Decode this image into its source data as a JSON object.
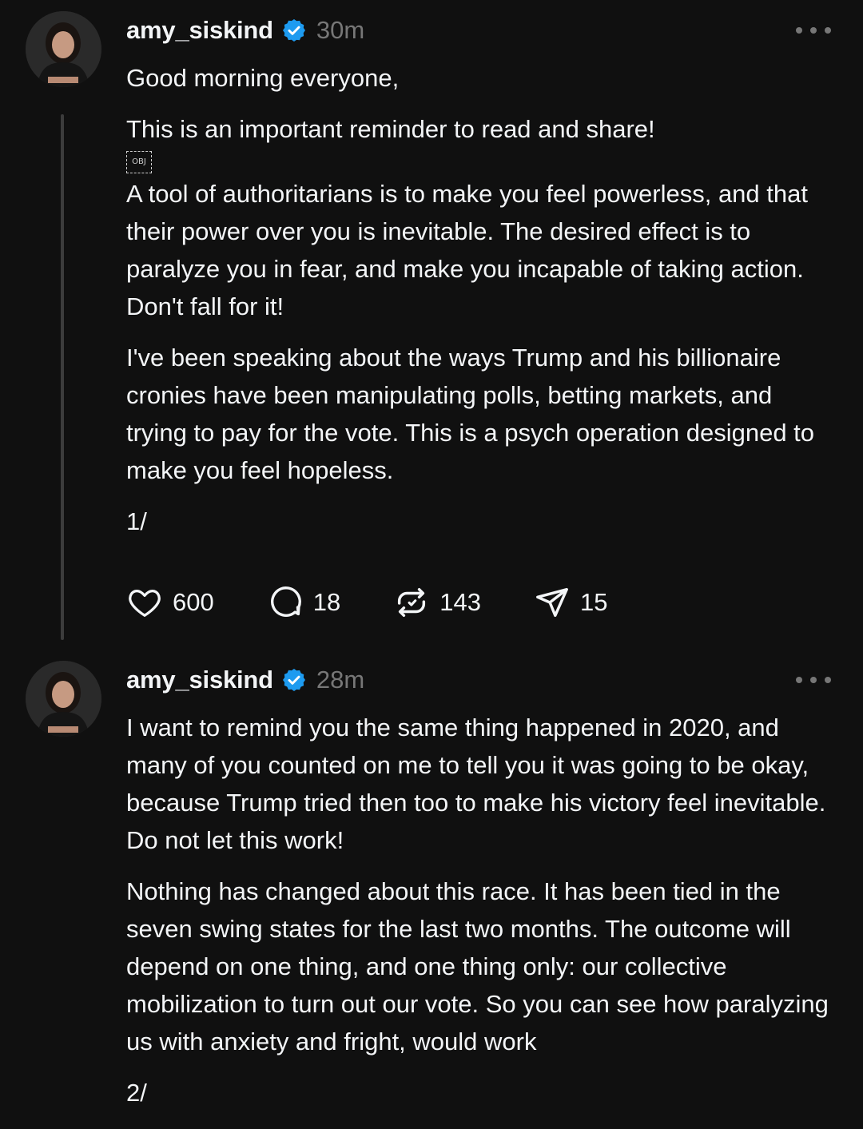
{
  "posts": [
    {
      "username": "amy_siskind",
      "timestamp": "30m",
      "paragraphs": [
        "Good morning everyone,",
        "This is an important reminder to read and share!",
        "A tool of authoritarians is to make you feel powerless, and that their power over you is inevitable. The desired effect is to paralyze you in fear, and make you incapable of taking action. Don't fall for it!",
        "I've been speaking about the ways Trump and his billionaire cronies have been manipulating polls, betting markets, and trying to pay for the vote. This is a psych operation designed to make you feel hopeless.",
        "1/"
      ],
      "obj_placeholder": "OBJ",
      "likes": "600",
      "replies": "18",
      "reposts": "143",
      "shares": "15"
    },
    {
      "username": "amy_siskind",
      "timestamp": "28m",
      "paragraphs": [
        "I want to remind you the same thing happened in 2020, and many of you counted on me to tell you it was going to be okay, because Trump tried then too to make his victory feel inevitable. Do not let this work!",
        "Nothing has changed about this race. It has been tied in the seven swing states for the last two months. The outcome will depend on one thing, and one thing only:  our collective mobilization to turn out our vote. So you can see how paralyzing us with anxiety and fright, would work",
        "2/"
      ]
    }
  ],
  "colors": {
    "background": "#101010",
    "text": "#f3f5f7",
    "muted": "#777777",
    "verified": "#1d9bf0",
    "thread_line": "#3c3c3c"
  },
  "icons": {
    "verified": "verified-badge-icon",
    "more": "more-horizontal-icon",
    "like": "heart-icon",
    "reply": "comment-bubble-icon",
    "repost": "repost-icon",
    "share": "send-icon"
  }
}
